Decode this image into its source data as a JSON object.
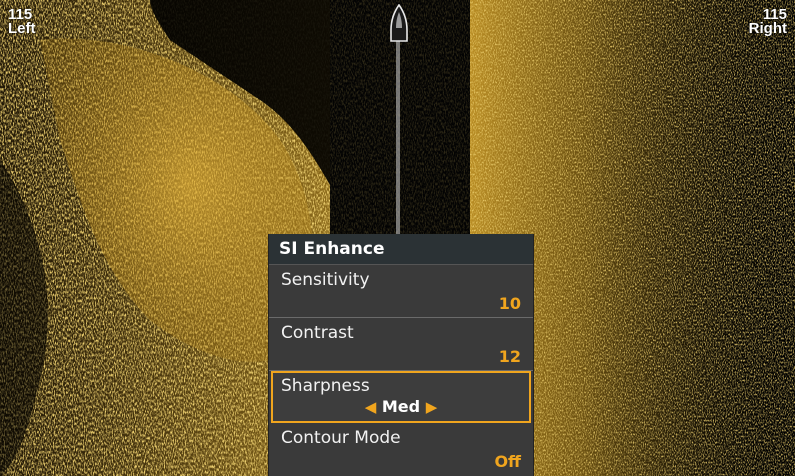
{
  "corners": {
    "left_range": "115",
    "left_label": "Left",
    "right_range": "115",
    "right_label": "Right"
  },
  "menu": {
    "title": "SI Enhance",
    "items": [
      {
        "label": "Sensitivity",
        "value": "10"
      },
      {
        "label": "Contrast",
        "value": "12"
      },
      {
        "label": "Sharpness",
        "value": "Med",
        "selected": true
      },
      {
        "label": "Contour Mode",
        "value": "Off"
      }
    ]
  },
  "colors": {
    "sonar_return": "#d9a52a",
    "accent": "#f0a51e",
    "menu_bg": "#3a3a3a",
    "menu_title_bg": "#2b3235"
  },
  "icons": {
    "boat": "boat-icon",
    "left_arrow": "left-triangle-icon",
    "right_arrow": "right-triangle-icon"
  }
}
